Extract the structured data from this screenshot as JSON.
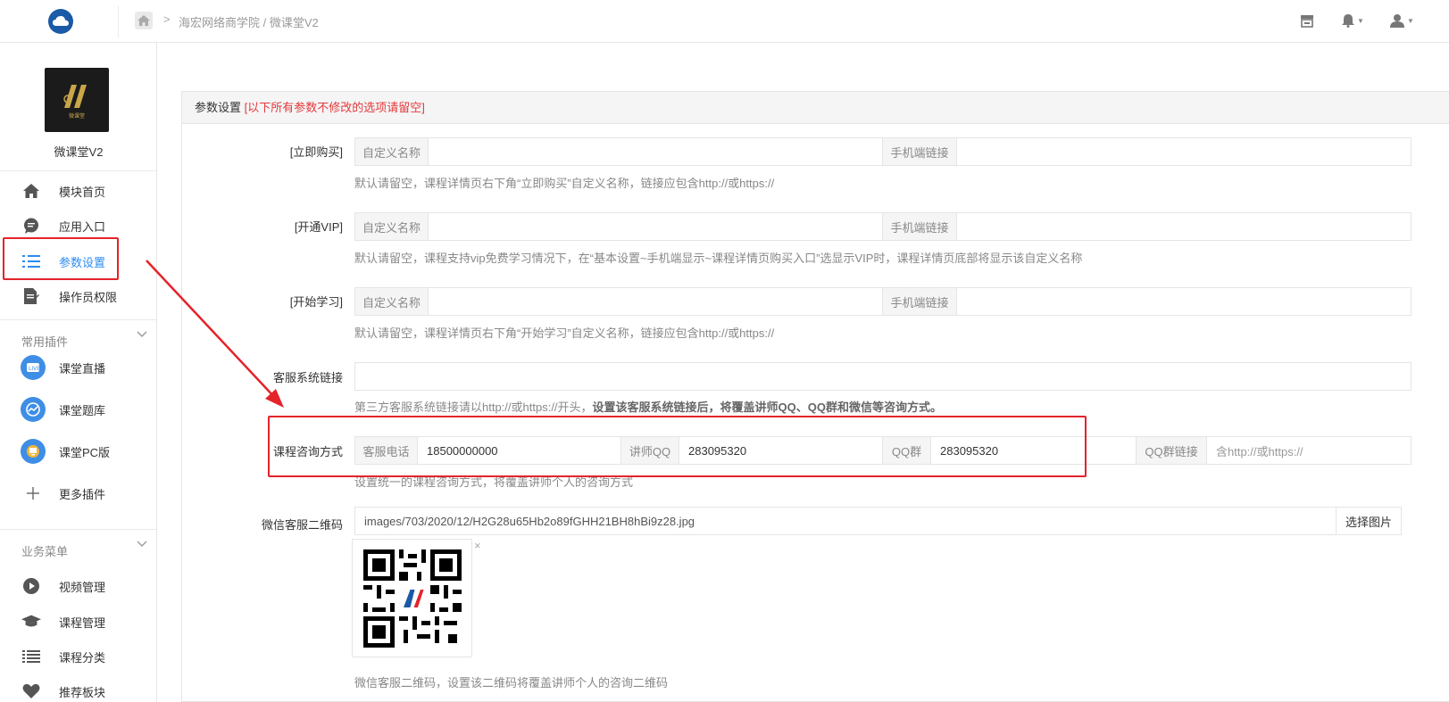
{
  "breadcrumb": {
    "text": "海宏网络商学院 / 微课堂V2"
  },
  "app": {
    "name": "微课堂V2",
    "thumb_text": "微课堂"
  },
  "sidebar": {
    "items": [
      {
        "label": "模块首页",
        "icon": "home-icon"
      },
      {
        "label": "应用入口",
        "icon": "chat-icon"
      },
      {
        "label": "参数设置",
        "icon": "list-icon",
        "active": true
      },
      {
        "label": "操作员权限",
        "icon": "edit-doc-icon"
      }
    ],
    "group1": {
      "title": "常用插件"
    },
    "plugins": [
      {
        "label": "课堂直播",
        "icon": "live-icon"
      },
      {
        "label": "课堂题库",
        "icon": "chart-icon"
      },
      {
        "label": "课堂PC版",
        "icon": "pc-icon"
      },
      {
        "label": "更多插件",
        "icon": "plus-icon"
      }
    ],
    "group2": {
      "title": "业务菜单"
    },
    "business": [
      {
        "label": "视频管理",
        "icon": "play-icon"
      },
      {
        "label": "课程管理",
        "icon": "graduation-cap-icon"
      },
      {
        "label": "课程分类",
        "icon": "list-icon"
      },
      {
        "label": "推荐板块",
        "icon": "heart-icon"
      }
    ]
  },
  "panel": {
    "title": "参数设置",
    "title_note": "[以下所有参数不修改的选项请留空]",
    "rows": {
      "buy_now": {
        "label": "[立即购买]",
        "name_addon": "自定义名称",
        "link_addon": "手机端链接",
        "name_value": "",
        "link_value": "",
        "help": "默认请留空，课程详情页右下角“立即购买”自定义名称，链接应包含http://或https://"
      },
      "vip": {
        "label": "[开通VIP]",
        "name_addon": "自定义名称",
        "link_addon": "手机端链接",
        "name_value": "",
        "link_value": "",
        "help": "默认请留空，课程支持vip免费学习情况下，在“基本设置~手机端显示~课程详情页购买入口”选显示VIP时，课程详情页底部将显示该自定义名称"
      },
      "start_study": {
        "label": "[开始学习]",
        "name_addon": "自定义名称",
        "link_addon": "手机端链接",
        "name_value": "",
        "link_value": "",
        "help": "默认请留空，课程详情页右下角“开始学习”自定义名称，链接应包含http://或https://"
      },
      "cs_link": {
        "label": "客服系统链接",
        "value": "",
        "help_normal": "第三方客服系统链接请以http://或https://开头，",
        "help_bold": "设置该客服系统链接后，将覆盖讲师QQ、QQ群和微信等咨询方式。"
      },
      "consult": {
        "label": "课程咨询方式",
        "phone_addon": "客服电话",
        "phone_value": "18500000000",
        "qq_addon": "讲师QQ",
        "qq_value": "283095320",
        "group_addon": "QQ群",
        "group_value": "283095320",
        "group_link_addon": "QQ群链接",
        "group_link_placeholder": "含http://或https://",
        "help": "设置统一的课程咨询方式，将覆盖讲师个人的咨询方式"
      },
      "wechat_qr": {
        "label": "微信客服二维码",
        "value": "images/703/2020/12/H2G28u65Hb2o89fGHH21BH8hBi9z28.jpg",
        "button": "选择图片",
        "remove": "×",
        "help": "微信客服二维码，设置该二维码将覆盖讲师个人的咨询二维码"
      }
    }
  },
  "colors": {
    "accent": "#2d8cf0",
    "annotation_red": "#e4232a",
    "brand": "#1a5aa6"
  }
}
